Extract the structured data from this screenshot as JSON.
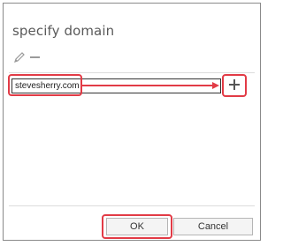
{
  "dialog": {
    "title": "specify domain"
  },
  "toolbar": {
    "edit_icon": "pencil-icon",
    "remove_icon": "minus-icon"
  },
  "domain_input": {
    "value": "stevesherry.com"
  },
  "add_button": {
    "icon": "plus-icon"
  },
  "footer": {
    "ok_label": "OK",
    "cancel_label": "Cancel"
  },
  "colors": {
    "highlight": "#e23b46",
    "border": "#8a8a8a"
  }
}
